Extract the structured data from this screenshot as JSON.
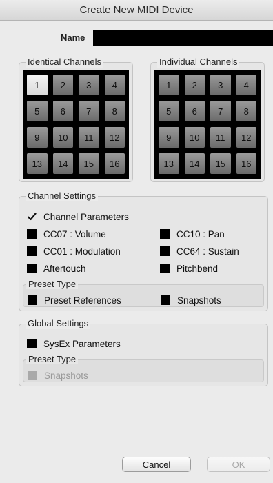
{
  "window": {
    "title": "Create New MIDI Device"
  },
  "name_field": {
    "label": "Name",
    "value": ""
  },
  "identical_channels": {
    "title": "Identical Channels",
    "channels": [
      "1",
      "2",
      "3",
      "4",
      "5",
      "6",
      "7",
      "8",
      "9",
      "10",
      "11",
      "12",
      "13",
      "14",
      "15",
      "16"
    ],
    "selected": [
      "1"
    ]
  },
  "individual_channels": {
    "title": "Individual Channels",
    "channels": [
      "1",
      "2",
      "3",
      "4",
      "5",
      "6",
      "7",
      "8",
      "9",
      "10",
      "11",
      "12",
      "13",
      "14",
      "15",
      "16"
    ],
    "selected": []
  },
  "channel_settings": {
    "title": "Channel Settings",
    "channel_parameters": {
      "label": "Channel Parameters",
      "checked": true
    },
    "cc07": {
      "label": "CC07 : Volume",
      "checked": false
    },
    "cc10": {
      "label": "CC10 : Pan",
      "checked": false
    },
    "cc01": {
      "label": "CC01 : Modulation",
      "checked": false
    },
    "cc64": {
      "label": "CC64 : Sustain",
      "checked": false
    },
    "aftertouch": {
      "label": "Aftertouch",
      "checked": false
    },
    "pitchbend": {
      "label": "Pitchbend",
      "checked": false
    },
    "preset_type": {
      "title": "Preset Type",
      "preset_references": {
        "label": "Preset References",
        "checked": false
      },
      "snapshots": {
        "label": "Snapshots",
        "checked": false
      }
    }
  },
  "global_settings": {
    "title": "Global Settings",
    "sysex": {
      "label": "SysEx Parameters",
      "checked": false
    },
    "preset_type": {
      "title": "Preset Type",
      "snapshots": {
        "label": "Snapshots",
        "checked": false,
        "disabled": true
      }
    }
  },
  "buttons": {
    "cancel": "Cancel",
    "ok": "OK"
  }
}
